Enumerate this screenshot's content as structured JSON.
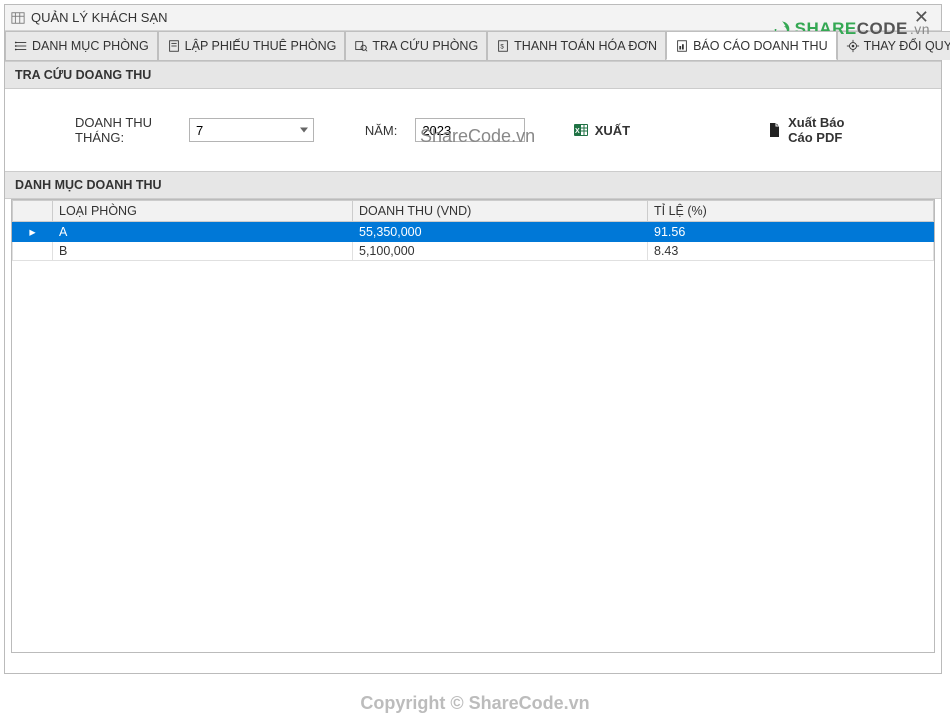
{
  "window": {
    "title": "QUẢN LÝ KHÁCH SẠN"
  },
  "tabs": [
    {
      "label": "DANH MỤC PHÒNG"
    },
    {
      "label": "LẬP PHIẾU THUÊ PHÒNG"
    },
    {
      "label": "TRA CỨU PHÒNG"
    },
    {
      "label": "THANH TOÁN HÓA ĐƠN"
    },
    {
      "label": "BÁO CÁO DOANH THU"
    },
    {
      "label": "THAY ĐỔI QUY ĐỊNH"
    }
  ],
  "sections": {
    "search_title": "TRA CỨU DOANG THU",
    "list_title": "DANH MỤC DOANH THU"
  },
  "filter": {
    "month_label": "DOANH THU THÁNG:",
    "month_value": "7",
    "year_label": "NĂM:",
    "year_value": "2023",
    "export_label": "XUẤT",
    "export_pdf_label": "Xuất Báo Cáo PDF"
  },
  "table": {
    "columns": {
      "loai": "LOẠI PHÒNG",
      "doanhthu": "DOANH THU (VND)",
      "tile": "TỈ LỆ (%)"
    },
    "rows": [
      {
        "loai": "A",
        "doanhthu": "55,350,000",
        "tile": "91.56",
        "selected": true
      },
      {
        "loai": "B",
        "doanhthu": "5,100,000",
        "tile": "8.43",
        "selected": false
      }
    ]
  },
  "watermark": {
    "center": "ShareCode.vn",
    "footer": "Copyright © ShareCode.vn",
    "brand_share": "SHARE",
    "brand_code": "CODE",
    "brand_suffix": ".vn"
  }
}
